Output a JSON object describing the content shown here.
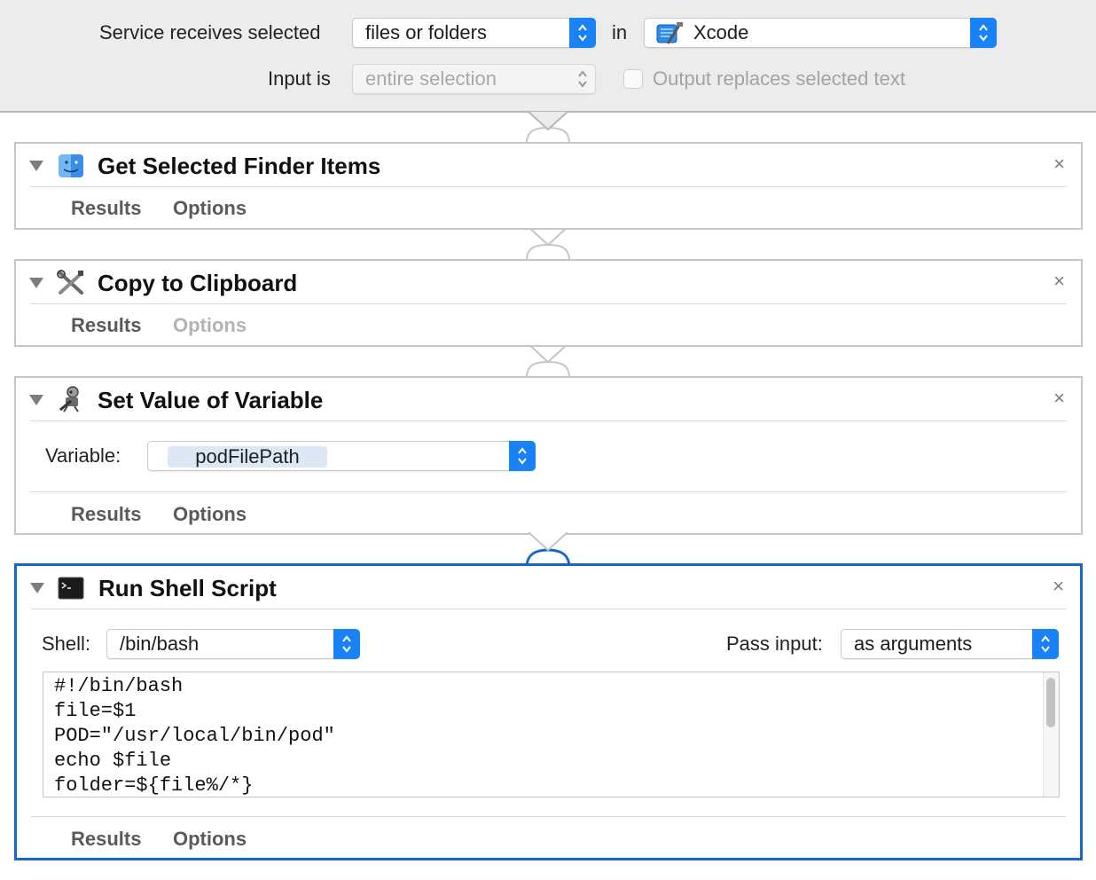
{
  "header": {
    "service_receives_label": "Service receives selected",
    "service_receives_value": "files or folders",
    "in_label": "in",
    "application_value": "Xcode",
    "input_is_label": "Input is",
    "input_is_value": "entire selection",
    "output_replaces_label": "Output replaces selected text",
    "output_replaces_checked": false
  },
  "actions": [
    {
      "title": "Get Selected Finder Items",
      "icon": "finder-icon",
      "tabs": [
        "Results",
        "Options"
      ],
      "options_enabled": true
    },
    {
      "title": "Copy to Clipboard",
      "icon": "tools-icon",
      "tabs": [
        "Results",
        "Options"
      ],
      "options_enabled": false
    },
    {
      "title": "Set Value of Variable",
      "icon": "automator-robot-icon",
      "variable_label": "Variable:",
      "variable_value": "podFilePath",
      "tabs": [
        "Results",
        "Options"
      ],
      "options_enabled": true
    },
    {
      "title": "Run Shell Script",
      "icon": "terminal-icon",
      "selected": true,
      "shell_label": "Shell:",
      "shell_value": "/bin/bash",
      "pass_input_label": "Pass input:",
      "pass_input_value": "as arguments",
      "script_lines": [
        "#!/bin/bash",
        "file=$1",
        "POD=\"/usr/local/bin/pod\"",
        "echo $file",
        "folder=${file%/*}"
      ],
      "tabs": [
        "Results",
        "Options"
      ],
      "options_enabled": true
    }
  ],
  "close_symbol": "×",
  "colors": {
    "accent": "#1a82f7",
    "selected_border": "#1767c9",
    "header_bg": "#ececec",
    "token_bg": "#dce8f6"
  }
}
